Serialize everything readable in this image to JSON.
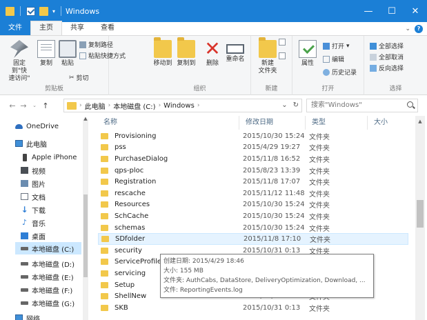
{
  "window": {
    "title": "Windows",
    "controls": [
      "—",
      "☐",
      "✕"
    ]
  },
  "tabs": [
    {
      "label": "文件"
    },
    {
      "label": "主页"
    },
    {
      "label": "共享"
    },
    {
      "label": "查看"
    }
  ],
  "ribbon": {
    "clipboard": {
      "label": "剪贴板",
      "pin": "固定到\"快\n速访问\"",
      "copy": "复制",
      "paste": "粘贴",
      "copy_path": "复制路径",
      "paste_shortcut": "粘贴快捷方式",
      "cut": "剪切"
    },
    "organize": {
      "label": "组织",
      "move_to": "移动到",
      "copy_to": "复制到",
      "delete": "删除",
      "rename": "重命名"
    },
    "new": {
      "label": "新建",
      "new_folder": "新建\n文件夹"
    },
    "open": {
      "label": "打开",
      "properties": "属性",
      "open": "打开",
      "edit": "编辑",
      "history": "历史记录"
    },
    "select": {
      "label": "选择",
      "select_all": "全部选择",
      "select_none": "全部取消",
      "invert": "反向选择"
    }
  },
  "address": {
    "crumbs": [
      "此电脑",
      "本地磁盘 (C:)",
      "Windows"
    ],
    "search_placeholder": "搜索\"Windows\""
  },
  "nav": {
    "items": [
      {
        "label": "OneDrive",
        "icon": "cloud-icon"
      },
      {
        "label": "此电脑",
        "icon": "computer-icon"
      },
      {
        "label": "Apple iPhone",
        "icon": "phone-icon"
      },
      {
        "label": "视频",
        "icon": "video-icon"
      },
      {
        "label": "图片",
        "icon": "picture-icon"
      },
      {
        "label": "文档",
        "icon": "document-icon"
      },
      {
        "label": "下载",
        "icon": "download-icon"
      },
      {
        "label": "音乐",
        "icon": "music-icon"
      },
      {
        "label": "桌面",
        "icon": "desktop-icon"
      },
      {
        "label": "本地磁盘 (C:)",
        "icon": "drive-icon"
      },
      {
        "label": "本地磁盘 (D:)",
        "icon": "drive-icon"
      },
      {
        "label": "本地磁盘 (E:)",
        "icon": "drive-icon"
      },
      {
        "label": "本地磁盘 (F:)",
        "icon": "drive-icon"
      },
      {
        "label": "本地磁盘 (G:)",
        "icon": "drive-icon"
      },
      {
        "label": "网络",
        "icon": "network-icon"
      }
    ]
  },
  "columns": {
    "name": "名称",
    "date": "修改日期",
    "type": "类型",
    "size": "大小"
  },
  "files": [
    {
      "name": "Provisioning",
      "date": "2015/10/30 15:24",
      "type": "文件夹"
    },
    {
      "name": "pss",
      "date": "2015/4/29 19:27",
      "type": "文件夹"
    },
    {
      "name": "PurchaseDialog",
      "date": "2015/11/8 16:52",
      "type": "文件夹"
    },
    {
      "name": "qps-ploc",
      "date": "2015/8/23 13:39",
      "type": "文件夹"
    },
    {
      "name": "Registration",
      "date": "2015/11/8 17:07",
      "type": "文件夹"
    },
    {
      "name": "rescache",
      "date": "2015/11/12 11:48",
      "type": "文件夹"
    },
    {
      "name": "Resources",
      "date": "2015/10/30 15:24",
      "type": "文件夹"
    },
    {
      "name": "SchCache",
      "date": "2015/10/30 15:24",
      "type": "文件夹"
    },
    {
      "name": "schemas",
      "date": "2015/10/30 15:24",
      "type": "文件夹"
    },
    {
      "name": "SDfolder",
      "date": "2015/11/8 17:10",
      "type": "文件夹"
    },
    {
      "name": "security",
      "date": "2015/10/31 0:13",
      "type": "文件夹"
    },
    {
      "name": "ServiceProfiles",
      "date": "",
      "type": ""
    },
    {
      "name": "servicing",
      "date": "",
      "type": ""
    },
    {
      "name": "Setup",
      "date": "",
      "type": ""
    },
    {
      "name": "ShellNew",
      "date": "2015/10/31 0:13",
      "type": "文件夹"
    },
    {
      "name": "SKB",
      "date": "2015/10/31 0:13",
      "type": "文件夹"
    }
  ],
  "tooltip": {
    "created": "创建日期: 2015/4/29 18:46",
    "size": "大小: 155 MB",
    "folders": "文件夹: AuthCabs, DataStore, DeliveryOptimization, Download, ...",
    "files": "文件: ReportingEvents.log"
  }
}
